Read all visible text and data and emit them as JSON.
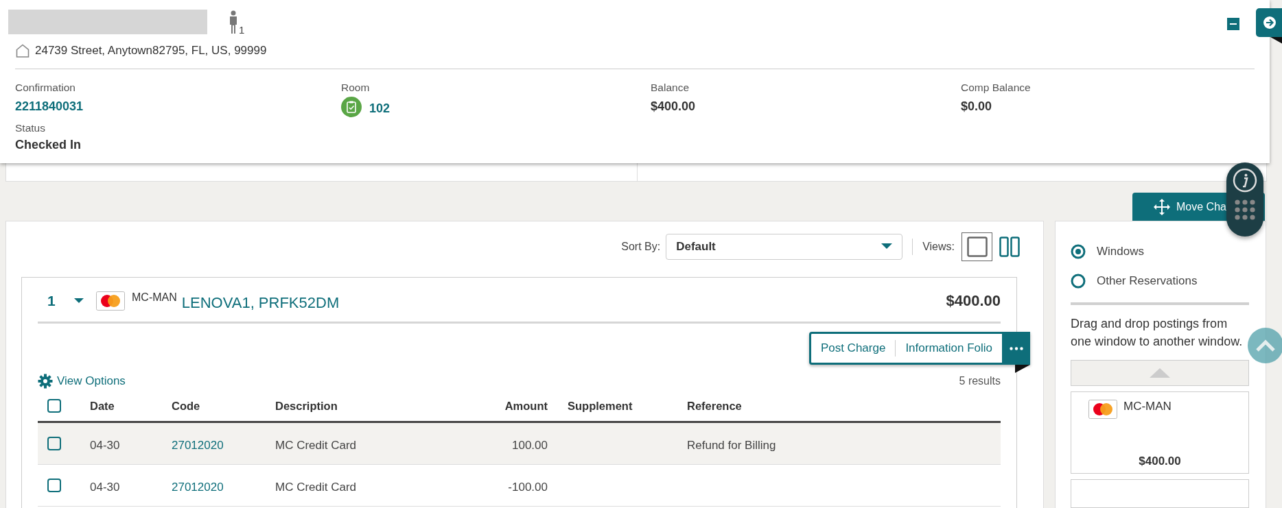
{
  "guest": {
    "count": "1",
    "address": "24739 Street, Anytown82795, FL, US, 99999"
  },
  "summary": [
    {
      "kind": "link",
      "label": "Confirmation",
      "value": "2211840031"
    },
    {
      "kind": "room",
      "label": "Room",
      "value": "102"
    },
    {
      "kind": "plain",
      "label": "Balance",
      "value": "$400.00"
    },
    {
      "kind": "plain",
      "label": "Comp Balance",
      "value": "$0.00"
    }
  ],
  "status": {
    "label": "Status",
    "value": "Checked In"
  },
  "move_button": "Move Cha",
  "sort": {
    "label": "Sort By:",
    "value": "Default"
  },
  "views": {
    "label": "Views:",
    "options": [
      {
        "kind": "single",
        "selected": true
      },
      {
        "kind": "split",
        "selected": false
      }
    ]
  },
  "folio": {
    "number": "1",
    "expanded": true,
    "all_checked": false,
    "payment": "MC-MAN",
    "name": "LENOVA1, PRFK52DM",
    "total": "$400.00",
    "actions": [
      "Post Charge",
      "Information Folio"
    ],
    "view_options": "View Options",
    "results": "5 results",
    "columns": [
      "Date",
      "Code",
      "Description",
      "Amount",
      "Supplement",
      "Reference"
    ],
    "rows": [
      {
        "selected": true,
        "checked": false,
        "date": "04-30",
        "code": "27012020",
        "description": "MC Credit Card",
        "amount": "100.00",
        "reference": "Refund for Billing"
      },
      {
        "selected": false,
        "checked": false,
        "date": "04-30",
        "code": "27012020",
        "description": "MC Credit Card",
        "amount": "-100.00"
      }
    ]
  },
  "move_panel": {
    "options": [
      {
        "label": "Windows",
        "selected": true
      },
      {
        "label": "Other Reservations",
        "selected": false
      }
    ],
    "hint": "Drag and drop postings from one window to another window.",
    "windows": [
      {
        "payment": "MC-MAN",
        "total": "$400.00"
      }
    ]
  }
}
